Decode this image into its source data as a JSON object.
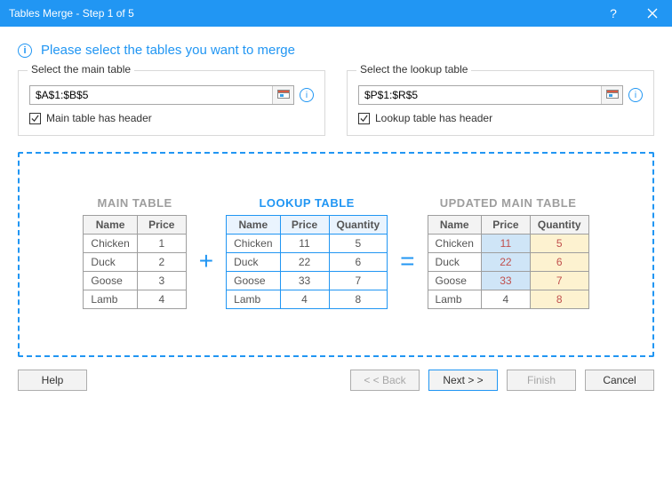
{
  "window": {
    "title": "Tables Merge - Step 1 of 5"
  },
  "heading": "Please select the tables you want to merge",
  "main_select": {
    "legend": "Select the main table",
    "value": "$A$1:$B$5",
    "checkbox_label": "Main table has header"
  },
  "lookup_select": {
    "legend": "Select the lookup table",
    "value": "$P$1:$R$5",
    "checkbox_label": "Lookup table has header"
  },
  "preview": {
    "main_title": "MAIN TABLE",
    "lookup_title": "LOOKUP TABLE",
    "updated_title": "UPDATED MAIN TABLE",
    "plus": "+",
    "equals": "=",
    "cols": {
      "name": "Name",
      "price": "Price",
      "qty": "Quantity"
    },
    "main": [
      {
        "name": "Chicken",
        "price": "1"
      },
      {
        "name": "Duck",
        "price": "2"
      },
      {
        "name": "Goose",
        "price": "3"
      },
      {
        "name": "Lamb",
        "price": "4"
      }
    ],
    "lookup": [
      {
        "name": "Chicken",
        "price": "11",
        "qty": "5"
      },
      {
        "name": "Duck",
        "price": "22",
        "qty": "6"
      },
      {
        "name": "Goose",
        "price": "33",
        "qty": "7"
      },
      {
        "name": "Lamb",
        "price": "4",
        "qty": "8"
      }
    ],
    "updated": [
      {
        "name": "Chicken",
        "price": "11",
        "qty": "5",
        "price_changed": true
      },
      {
        "name": "Duck",
        "price": "22",
        "qty": "6",
        "price_changed": true
      },
      {
        "name": "Goose",
        "price": "33",
        "qty": "7",
        "price_changed": true
      },
      {
        "name": "Lamb",
        "price": "4",
        "qty": "8",
        "price_changed": false
      }
    ]
  },
  "buttons": {
    "help": "Help",
    "back": "< < Back",
    "next": "Next > >",
    "finish": "Finish",
    "cancel": "Cancel"
  }
}
